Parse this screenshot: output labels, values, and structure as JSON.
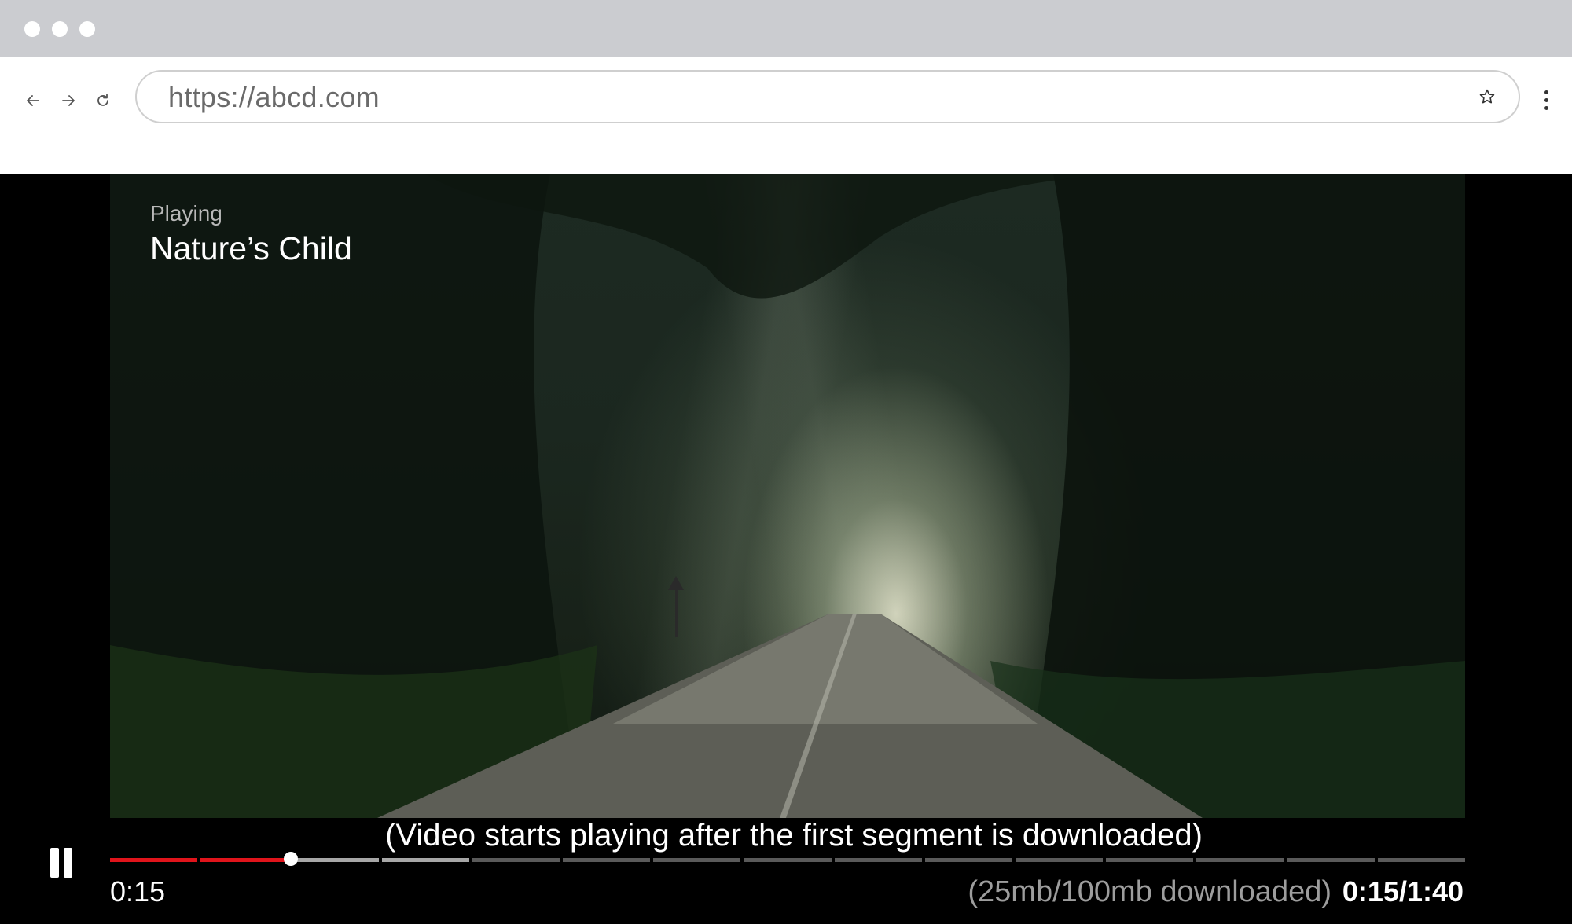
{
  "browser": {
    "url": "https://abcd.com",
    "back_icon": "arrow-left-icon",
    "forward_icon": "arrow-right-icon",
    "reload_icon": "reload-icon",
    "bookmark_icon": "star-icon",
    "menu_icon": "kebab-menu-icon"
  },
  "player": {
    "status_label": "Playing",
    "title": "Nature’s Child",
    "buffer_caption": "(Video starts playing after the first segment is downloaded)",
    "current_time": "0:15",
    "download_status": "(25mb/100mb downloaded)",
    "time_display": "0:15/1:40",
    "progress_fraction": 0.15,
    "downloaded_fraction": 0.25,
    "segment_count": 15,
    "colors": {
      "played": "#e0141b",
      "buffered": "#a7a7a7",
      "unbuffered": "#5a5a5a",
      "background": "#000000"
    }
  }
}
